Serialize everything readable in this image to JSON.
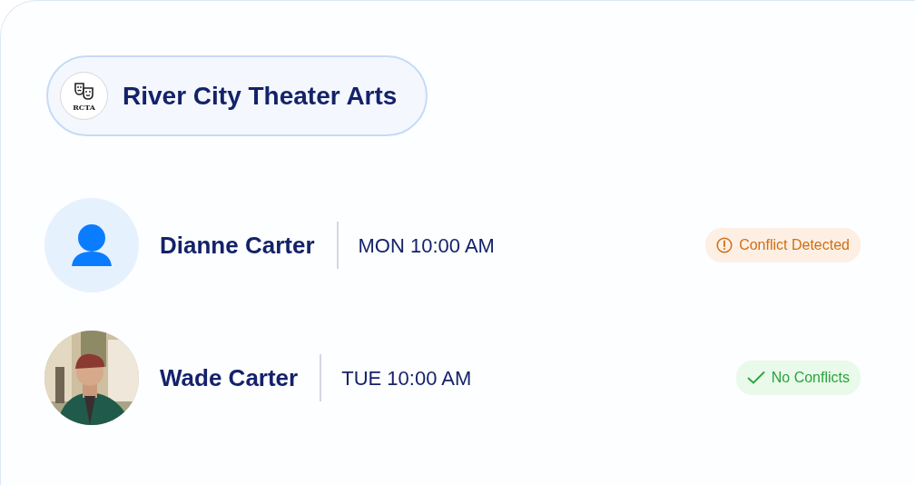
{
  "organization": {
    "logo_text": "RCTA",
    "name": "River City Theater Arts"
  },
  "people": [
    {
      "name": "Dianne Carter",
      "time": "MON 10:00 AM",
      "avatar": {
        "kind": "placeholder"
      },
      "status": {
        "kind": "conflict",
        "label": "Conflict Detected"
      }
    },
    {
      "name": "Wade Carter",
      "time": "TUE 10:00 AM",
      "status": {
        "kind": "ok",
        "label": "No Conflicts"
      }
    }
  ]
}
